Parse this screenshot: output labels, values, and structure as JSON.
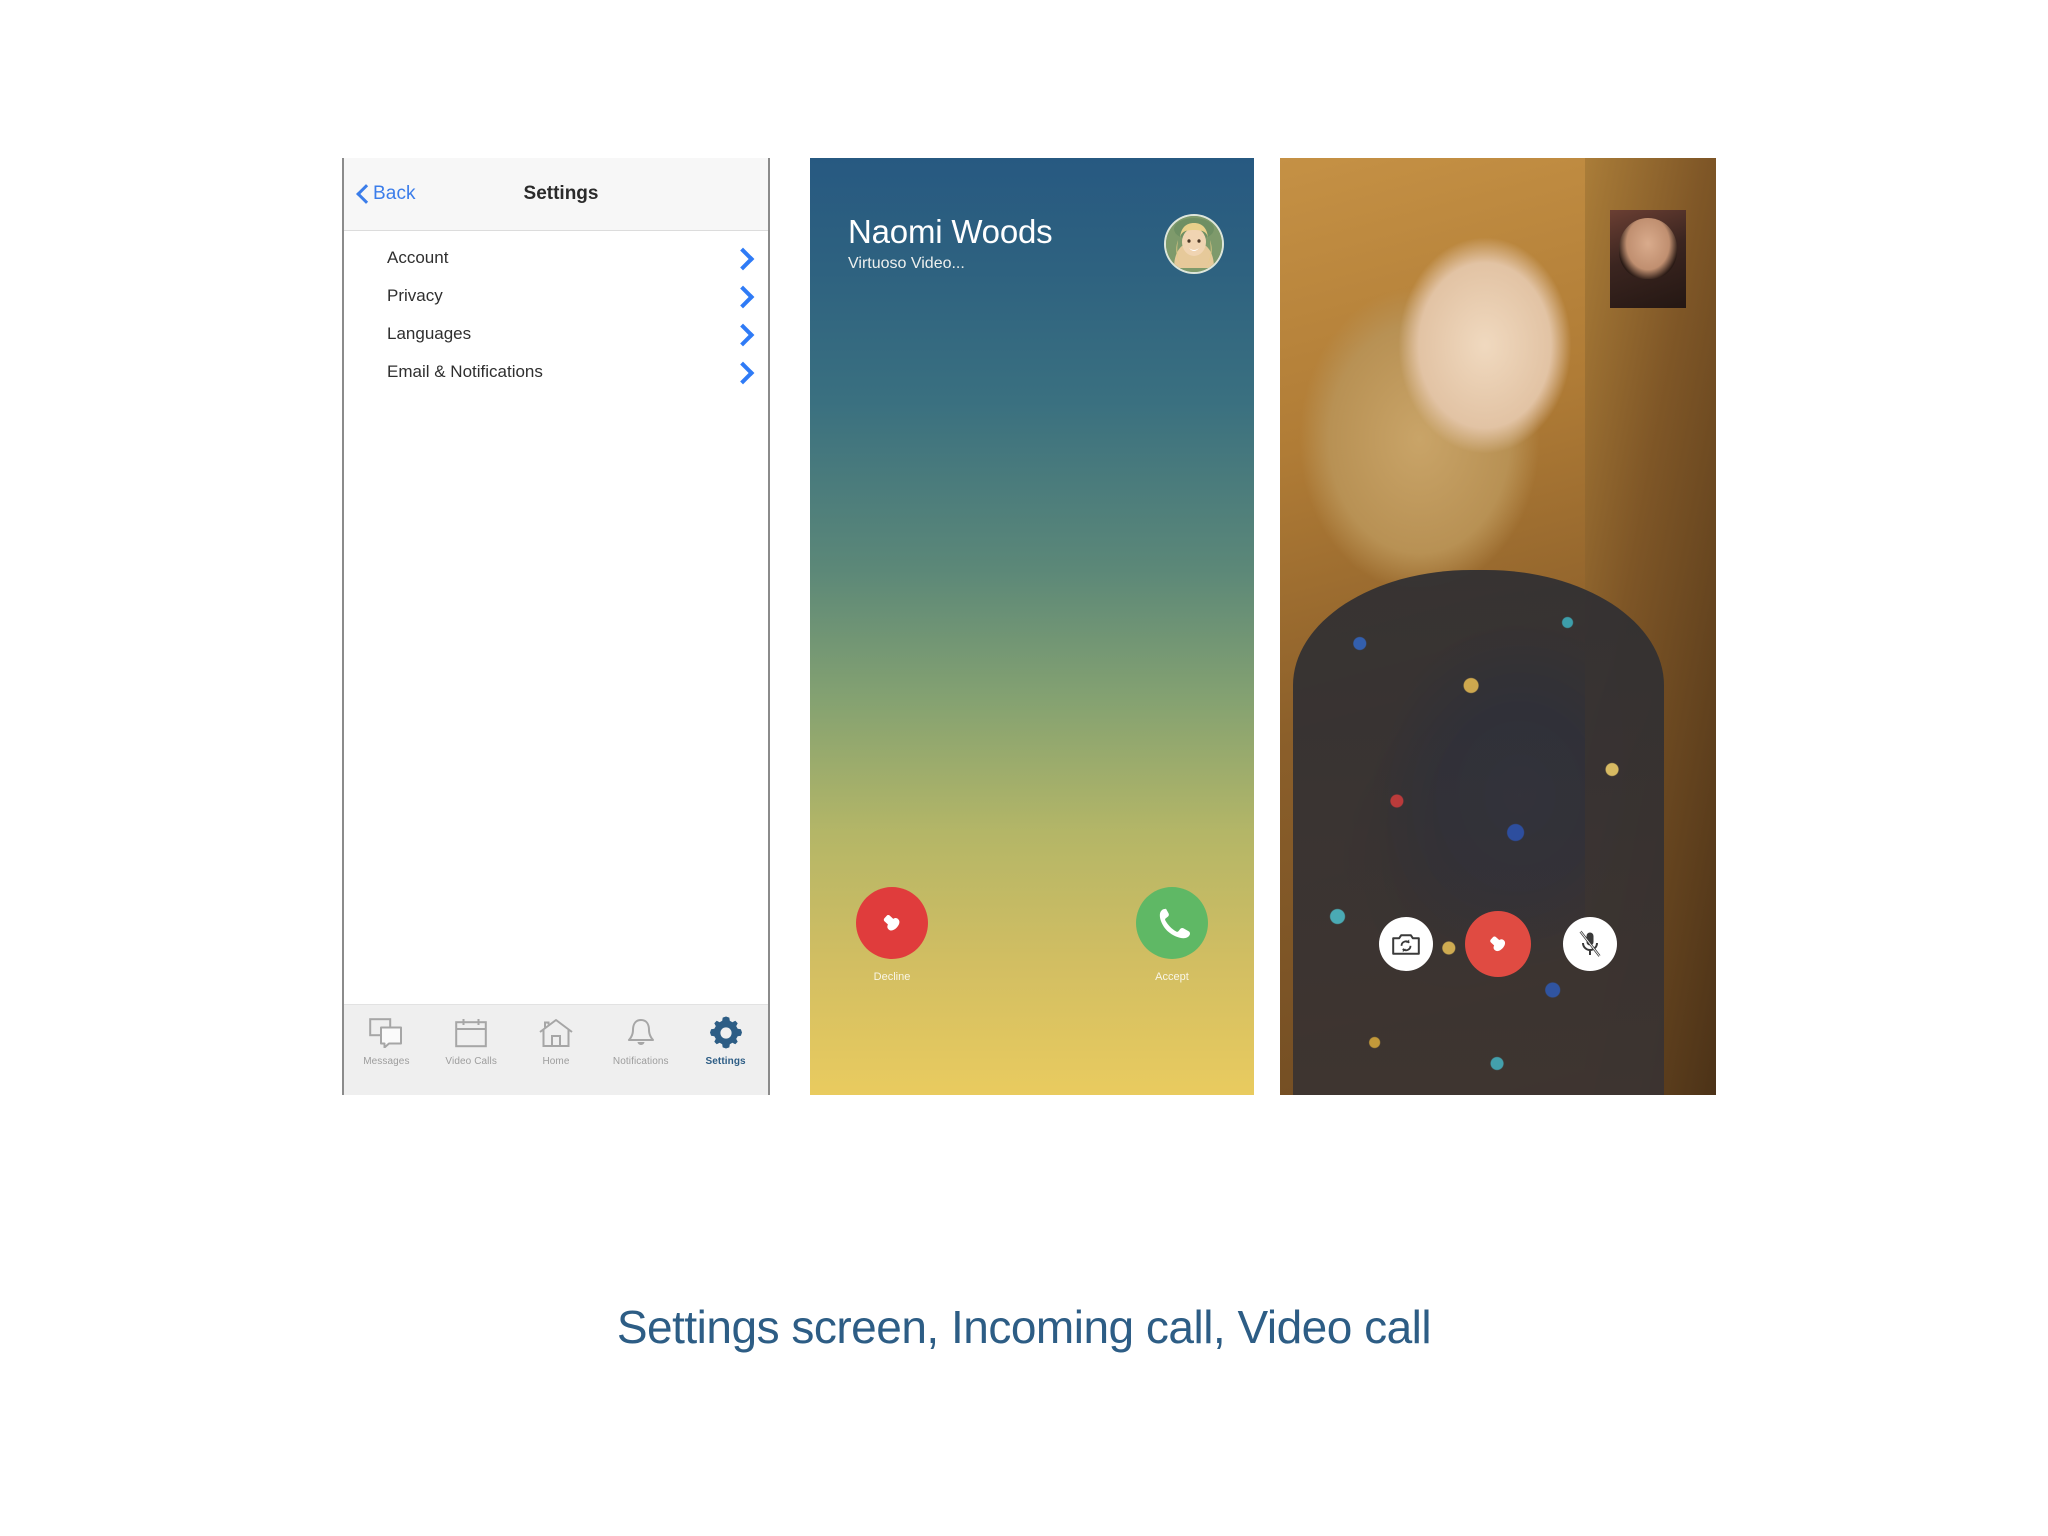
{
  "caption": "Settings screen, Incoming call, Video call",
  "settings_screen": {
    "nav": {
      "back_label": "Back",
      "title": "Settings",
      "back_icon": "chevron-left-icon",
      "back_color": "#3b7dea"
    },
    "rows": [
      {
        "label": "Account",
        "chevron": "chevron-right-icon"
      },
      {
        "label": "Privacy",
        "chevron": "chevron-right-icon"
      },
      {
        "label": "Languages",
        "chevron": "chevron-right-icon"
      },
      {
        "label": "Email & Notifications",
        "chevron": "chevron-right-icon"
      }
    ],
    "tab_bar": {
      "active_index": 4,
      "active_color": "#2d5d85",
      "inactive_color": "#9d9d9d",
      "items": [
        {
          "label": "Messages",
          "icon": "messages-icon"
        },
        {
          "label": "Video Calls",
          "icon": "calendar-icon"
        },
        {
          "label": "Home",
          "icon": "home-icon"
        },
        {
          "label": "Notifications",
          "icon": "bell-icon"
        },
        {
          "label": "Settings",
          "icon": "gear-icon"
        }
      ]
    }
  },
  "incoming_call": {
    "caller_name": "Naomi Woods",
    "caller_subtitle": "Virtuoso Video...",
    "avatar": "caller-avatar-photo",
    "gradient_top": "#275981",
    "gradient_bottom": "#e9cb5f",
    "actions": [
      {
        "label": "Decline",
        "icon": "phone-hangup-icon",
        "color": "#e03c3c"
      },
      {
        "label": "Accept",
        "icon": "phone-icon",
        "color": "#5fb865"
      }
    ]
  },
  "video_call": {
    "self_view": "self-view-thumbnail",
    "controls": [
      {
        "name": "switch-camera",
        "icon": "camera-flip-icon",
        "color": "#ffffff"
      },
      {
        "name": "end-call",
        "icon": "phone-hangup-icon",
        "color": "#e04b42"
      },
      {
        "name": "mute-microphone",
        "icon": "microphone-muted-icon",
        "color": "#ffffff"
      }
    ]
  }
}
